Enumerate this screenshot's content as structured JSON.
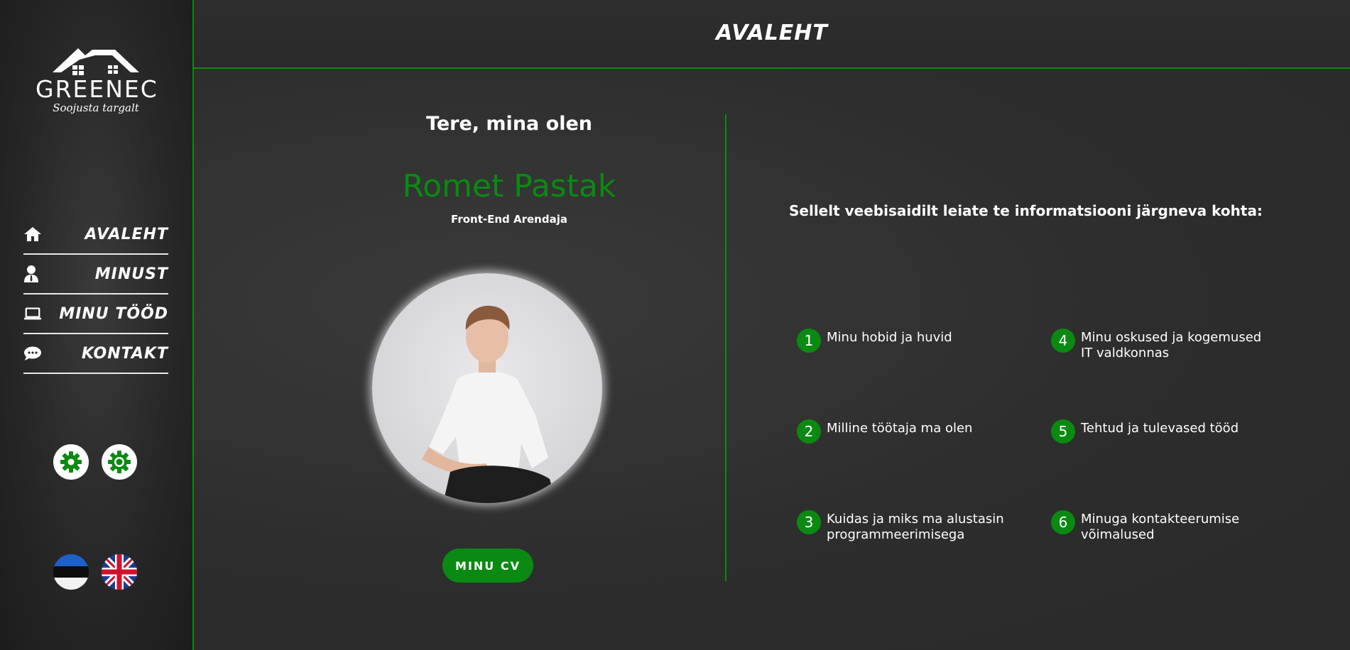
{
  "brand": {
    "name": "GREENEC",
    "tagline": "Soojusta targalt"
  },
  "header": {
    "title": "AVALEHT"
  },
  "nav": {
    "items": [
      {
        "label": "AVALEHT",
        "icon": "home-icon"
      },
      {
        "label": "MINUST",
        "icon": "user-icon"
      },
      {
        "label": "MINU TÖÖD",
        "icon": "laptop-icon"
      },
      {
        "label": "KONTAKT",
        "icon": "chat-icon"
      }
    ]
  },
  "settings": {
    "buttons": [
      {
        "icon": "gear-icon"
      },
      {
        "icon": "theme-gear-icon"
      }
    ]
  },
  "languages": [
    {
      "code": "et",
      "icon": "estonia-flag-icon"
    },
    {
      "code": "en",
      "icon": "uk-flag-icon"
    }
  ],
  "hero": {
    "greeting": "Tere, mina olen",
    "name": "Romet Pastak",
    "role": "Front-End Arendaja",
    "cv_button": "MINU CV"
  },
  "info": {
    "intro": "Sellelt veebisaidilt leiate te informatsiooni järgneva kohta:",
    "topics": [
      {
        "num": "1",
        "text": "Minu hobid ja huvid"
      },
      {
        "num": "2",
        "text": "Milline töötaja ma olen"
      },
      {
        "num": "3",
        "text": "Kuidas ja miks ma alustasin programmeerimisega"
      },
      {
        "num": "4",
        "text": "Minu oskused ja kogemused IT valdkonnas"
      },
      {
        "num": "5",
        "text": "Tehtud ja tulevased tööd"
      },
      {
        "num": "6",
        "text": "Minuga kontakteerumise võimalused"
      }
    ]
  },
  "colors": {
    "accent": "#0a8a12",
    "background": "#2b2b2b",
    "text": "#ffffff"
  }
}
